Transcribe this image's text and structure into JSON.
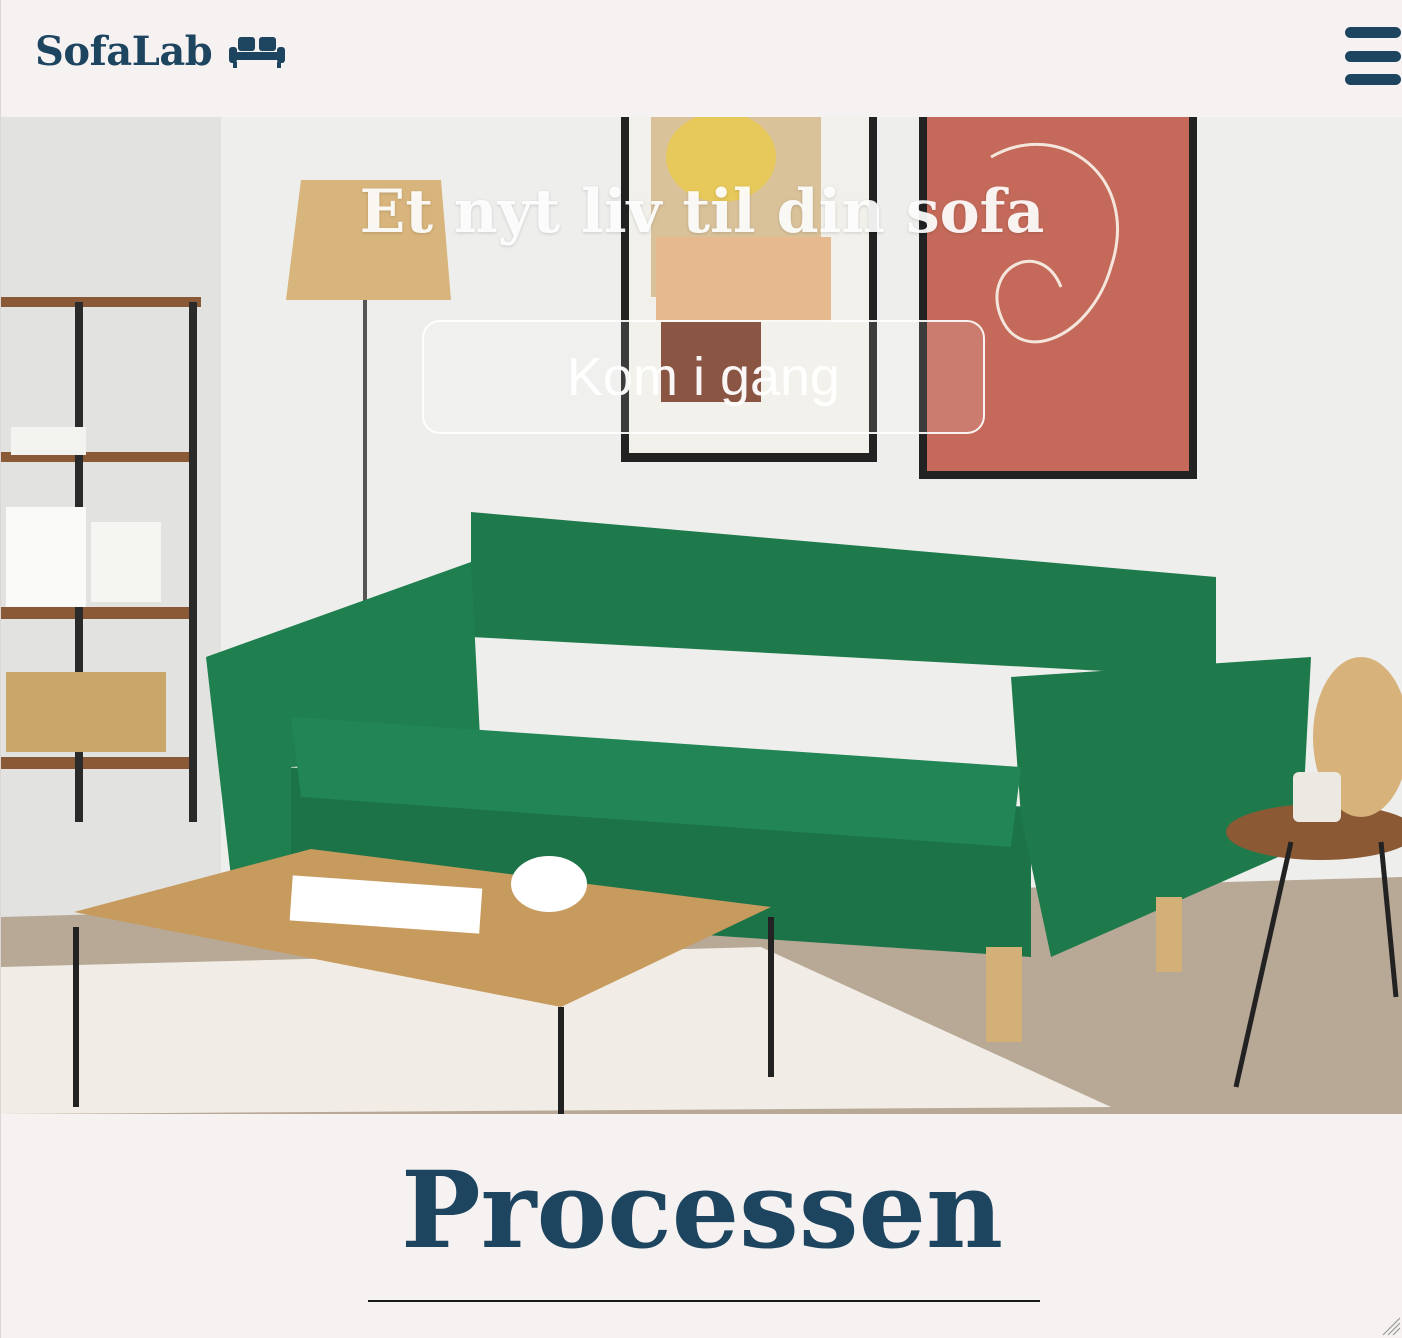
{
  "header": {
    "brand_name": "SofaLab",
    "brand_icon": "sofa-icon",
    "menu_icon": "hamburger-menu-icon"
  },
  "hero": {
    "title": "Et nyt liv til din sofa",
    "cta_label": "Kom i gang",
    "image": "living-room-green-velvet-sofa-photo"
  },
  "process": {
    "title": "Processen"
  },
  "colors": {
    "brand": "#1e4560",
    "background": "#f7f2f2",
    "sofa_green": "#1d7a4e"
  }
}
